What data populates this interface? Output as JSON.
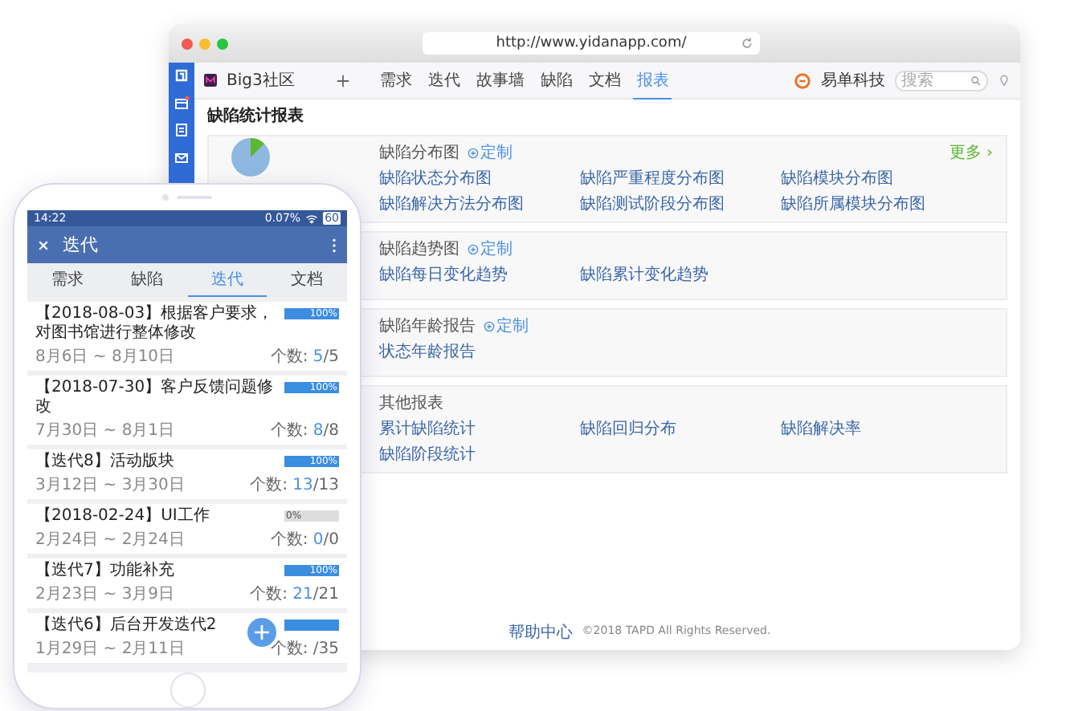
{
  "browser": {
    "url": "http://www.yidanapp.com/",
    "project": "Big3社区",
    "nav": [
      {
        "label": "需求",
        "selected": false
      },
      {
        "label": "迭代",
        "selected": false
      },
      {
        "label": "故事墙",
        "selected": false
      },
      {
        "label": "缺陷",
        "selected": false
      },
      {
        "label": "文档",
        "selected": false
      },
      {
        "label": "报表",
        "selected": true
      }
    ],
    "brand": "易单科技",
    "search": {
      "placeholder": "搜索"
    },
    "page_title": "缺陷统计报表",
    "cards": [
      {
        "title": "缺陷分布图",
        "custom": "定制",
        "chart": true,
        "more": "更多 ›",
        "links": [
          "缺陷状态分布图",
          "缺陷严重程度分布图",
          "缺陷模块分布图",
          "缺陷解决方法分布图",
          "缺陷测试阶段分布图",
          "缺陷所属模块分布图"
        ]
      },
      {
        "title": "缺陷趋势图",
        "custom": "定制",
        "links": [
          "缺陷每日变化趋势",
          "缺陷累计变化趋势"
        ]
      },
      {
        "title": "缺陷年龄报告",
        "custom": "定制",
        "links": [
          "状态年龄报告"
        ]
      },
      {
        "title": "其他报表",
        "links": [
          "累计缺陷统计",
          "缺陷回归分布",
          "缺陷解决率",
          "缺陷阶段统计"
        ]
      }
    ],
    "footer": {
      "link": "帮助中心",
      "copyright": "©2018 TAPD All Rights Reserved."
    }
  },
  "phone": {
    "time": "14:22",
    "net": "0.07%",
    "battery": "60",
    "title": "迭代",
    "tabs": [
      {
        "label": "需求",
        "selected": false
      },
      {
        "label": "缺陷",
        "selected": false
      },
      {
        "label": "迭代",
        "selected": true
      },
      {
        "label": "文档",
        "selected": false
      }
    ],
    "items": [
      {
        "title": "【2018-08-03】根据客户要求，对图书馆进行整体修改",
        "dates": "8月6日 ~ 8月10日",
        "level": 1,
        "percent": "100%",
        "count_label": "个数:",
        "done": "5",
        "total": "/5"
      },
      {
        "title": "【2018-07-30】客户反馈问题修改",
        "dates": "7月30日 ~ 8月1日",
        "level": 1,
        "percent": "100%",
        "count_label": "个数:",
        "done": "8",
        "total": "/8"
      },
      {
        "title": "【迭代8】活动版块",
        "dates": "3月12日 ~ 3月30日",
        "level": 1,
        "percent": "100%",
        "count_label": "个数:",
        "done": "13",
        "total": "/13"
      },
      {
        "title": "【2018-02-24】UI工作",
        "dates": "2月24日 ~ 2月24日",
        "level": 0,
        "percent": "0%",
        "count_label": "个数:",
        "done": "0",
        "total": "/0"
      },
      {
        "title": "【迭代7】功能补充",
        "dates": "2月23日 ~ 3月9日",
        "level": 1,
        "percent": "100%",
        "count_label": "个数:",
        "done": "21",
        "total": "/21"
      },
      {
        "title": "【迭代6】后台开发迭代2",
        "dates": "1月29日 ~ 2月11日",
        "level": 1,
        "count_label": "个数:",
        "total": "/35"
      }
    ]
  }
}
